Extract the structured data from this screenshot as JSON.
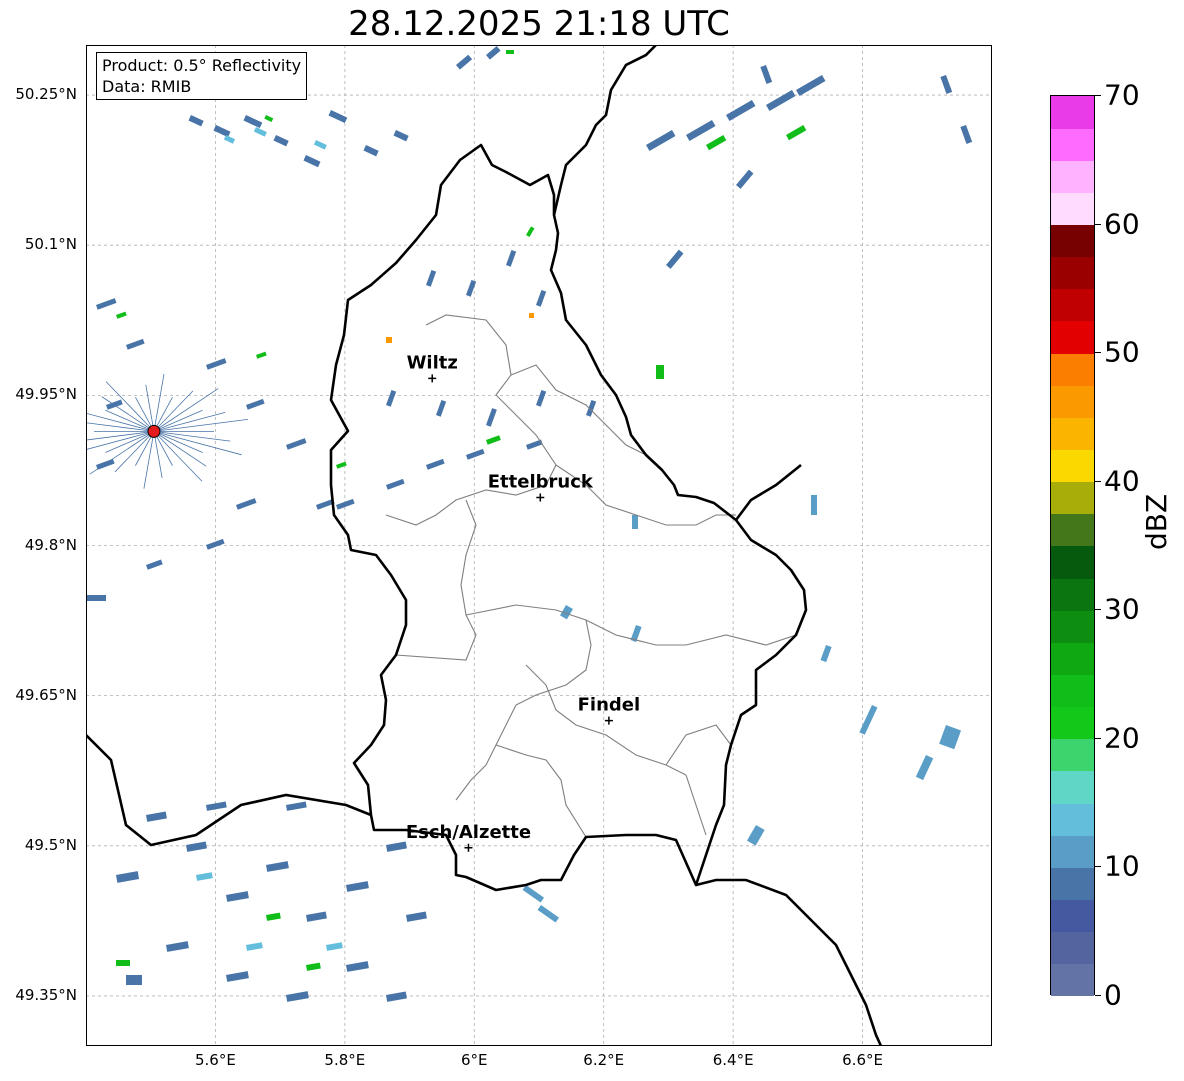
{
  "title": "28.12.2025 21:18 UTC",
  "info": {
    "product": "Product: 0.5° Reflectivity",
    "data": "Data: RMIB"
  },
  "map": {
    "lon_range": [
      5.4,
      6.8
    ],
    "lat_range": [
      49.3,
      50.3
    ],
    "lat_ticks": [
      "50.25°N",
      "50.1°N",
      "49.95°N",
      "49.8°N",
      "49.65°N",
      "49.5°N",
      "49.35°N"
    ],
    "lat_tick_values": [
      50.25,
      50.1,
      49.95,
      49.8,
      49.65,
      49.5,
      49.35
    ],
    "lon_ticks": [
      "5.6°E",
      "5.8°E",
      "6°E",
      "6.2°E",
      "6.4°E",
      "6.6°E"
    ],
    "lon_tick_values": [
      5.6,
      5.8,
      6.0,
      6.2,
      6.4,
      6.6
    ],
    "cities": [
      {
        "name": "Wiltz",
        "lon": 5.935,
        "lat": 49.967
      },
      {
        "name": "Ettelbruck",
        "lon": 6.102,
        "lat": 49.848
      },
      {
        "name": "Findel",
        "lon": 6.208,
        "lat": 49.625
      },
      {
        "name": "Esch/Alzette",
        "lon": 5.991,
        "lat": 49.498
      }
    ],
    "radar_site": {
      "lon": 5.505,
      "lat": 49.914
    },
    "colors": {
      "border": "#000000",
      "canton": "#7f7f7f",
      "grid": "#b0b0b0",
      "radar_site": "#e41a1c"
    }
  },
  "colorbar": {
    "label": "dBZ",
    "ticks": [
      "0",
      "10",
      "20",
      "30",
      "40",
      "50",
      "60",
      "70"
    ],
    "tick_values": [
      0,
      10,
      20,
      30,
      40,
      50,
      60,
      70
    ],
    "range": [
      0,
      70
    ],
    "step": 2.5,
    "colors": [
      "#6473a6",
      "#53649f",
      "#44599f",
      "#4874a8",
      "#5a9ec8",
      "#63bedc",
      "#60d6c6",
      "#3dd36d",
      "#14c81a",
      "#11bd18",
      "#0fa812",
      "#0e8e10",
      "#0b7610",
      "#065a0d",
      "#44761a",
      "#a9ad0a",
      "#fbd800",
      "#fbb500",
      "#fb9900",
      "#fb7e00",
      "#e20000",
      "#c00000",
      "#9a0000",
      "#770000",
      "#ffdcff",
      "#ffb2ff",
      "#ff6bff",
      "#e93be8"
    ]
  }
}
